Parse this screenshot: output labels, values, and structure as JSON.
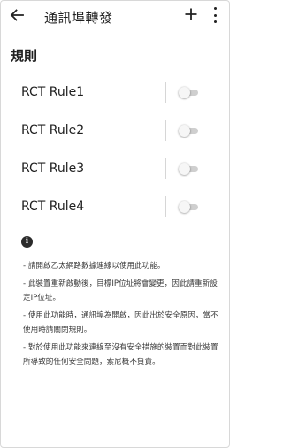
{
  "header": {
    "back_icon": "arrow-left-icon",
    "title": "通訊埠轉發",
    "add_icon": "plus-icon",
    "more_icon": "more-vertical-icon"
  },
  "section": {
    "title": "規則"
  },
  "rules": [
    {
      "label": "RCT Rule1",
      "enabled": false
    },
    {
      "label": "RCT Rule2",
      "enabled": false
    },
    {
      "label": "RCT Rule3",
      "enabled": false
    },
    {
      "label": "RCT Rule4",
      "enabled": false
    }
  ],
  "info": {
    "icon": "info-icon",
    "notes": [
      "- 請開啟乙太網路數據連線以使用此功能。",
      "- 此裝置重新啟動後，目標IP位址將會變更，因此請重新設定IP位址。",
      "- 使用此功能時，通訊埠為開啟，因此出於安全原因，當不使用時請關閉規則。",
      "- 對於使用此功能來連線至沒有安全措施的裝置而對此裝置所導致的任何安全問題，索尼概不負責。"
    ]
  },
  "colors": {
    "toggle_track": "#cfcfcf",
    "toggle_thumb": "#f6f6f6",
    "text": "#202020"
  }
}
